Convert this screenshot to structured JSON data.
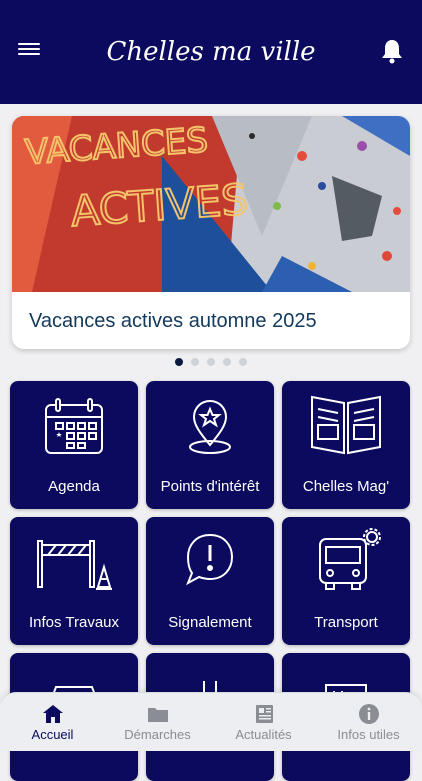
{
  "header": {
    "logo_text": "Chelles ma ville",
    "menu_icon": "hamburger-menu-icon",
    "notification_icon": "bell-icon",
    "background_color": "#0b0a5e"
  },
  "carousel": {
    "title": "Vacances actives automne 2025",
    "image_text": "VACANCES ACTIVES",
    "slide_count": 5,
    "active_slide": 1
  },
  "tiles": [
    {
      "label": "Agenda",
      "icon": "calendar-icon"
    },
    {
      "label": "Points d'intérêt",
      "icon": "map-pin-star-icon"
    },
    {
      "label": "Chelles Mag'",
      "icon": "magazine-icon"
    },
    {
      "label": "Infos Travaux",
      "icon": "roadworks-barrier-icon"
    },
    {
      "label": "Signalement",
      "icon": "alert-bubble-icon"
    },
    {
      "label": "Transport",
      "icon": "bus-icon"
    },
    {
      "label": "",
      "icon": "car-icon"
    },
    {
      "label": "",
      "icon": "person-icon"
    },
    {
      "label": "",
      "icon": "document-icon"
    }
  ],
  "tabbar": {
    "tabs": [
      {
        "label": "Accueil",
        "icon": "home-icon",
        "active": true
      },
      {
        "label": "Démarches",
        "icon": "folder-icon",
        "active": false
      },
      {
        "label": "Actualités",
        "icon": "newspaper-icon",
        "active": false
      },
      {
        "label": "Infos utiles",
        "icon": "info-icon",
        "active": false
      }
    ],
    "active_color": "#0b0a5e",
    "inactive_color": "#8a8d93"
  }
}
